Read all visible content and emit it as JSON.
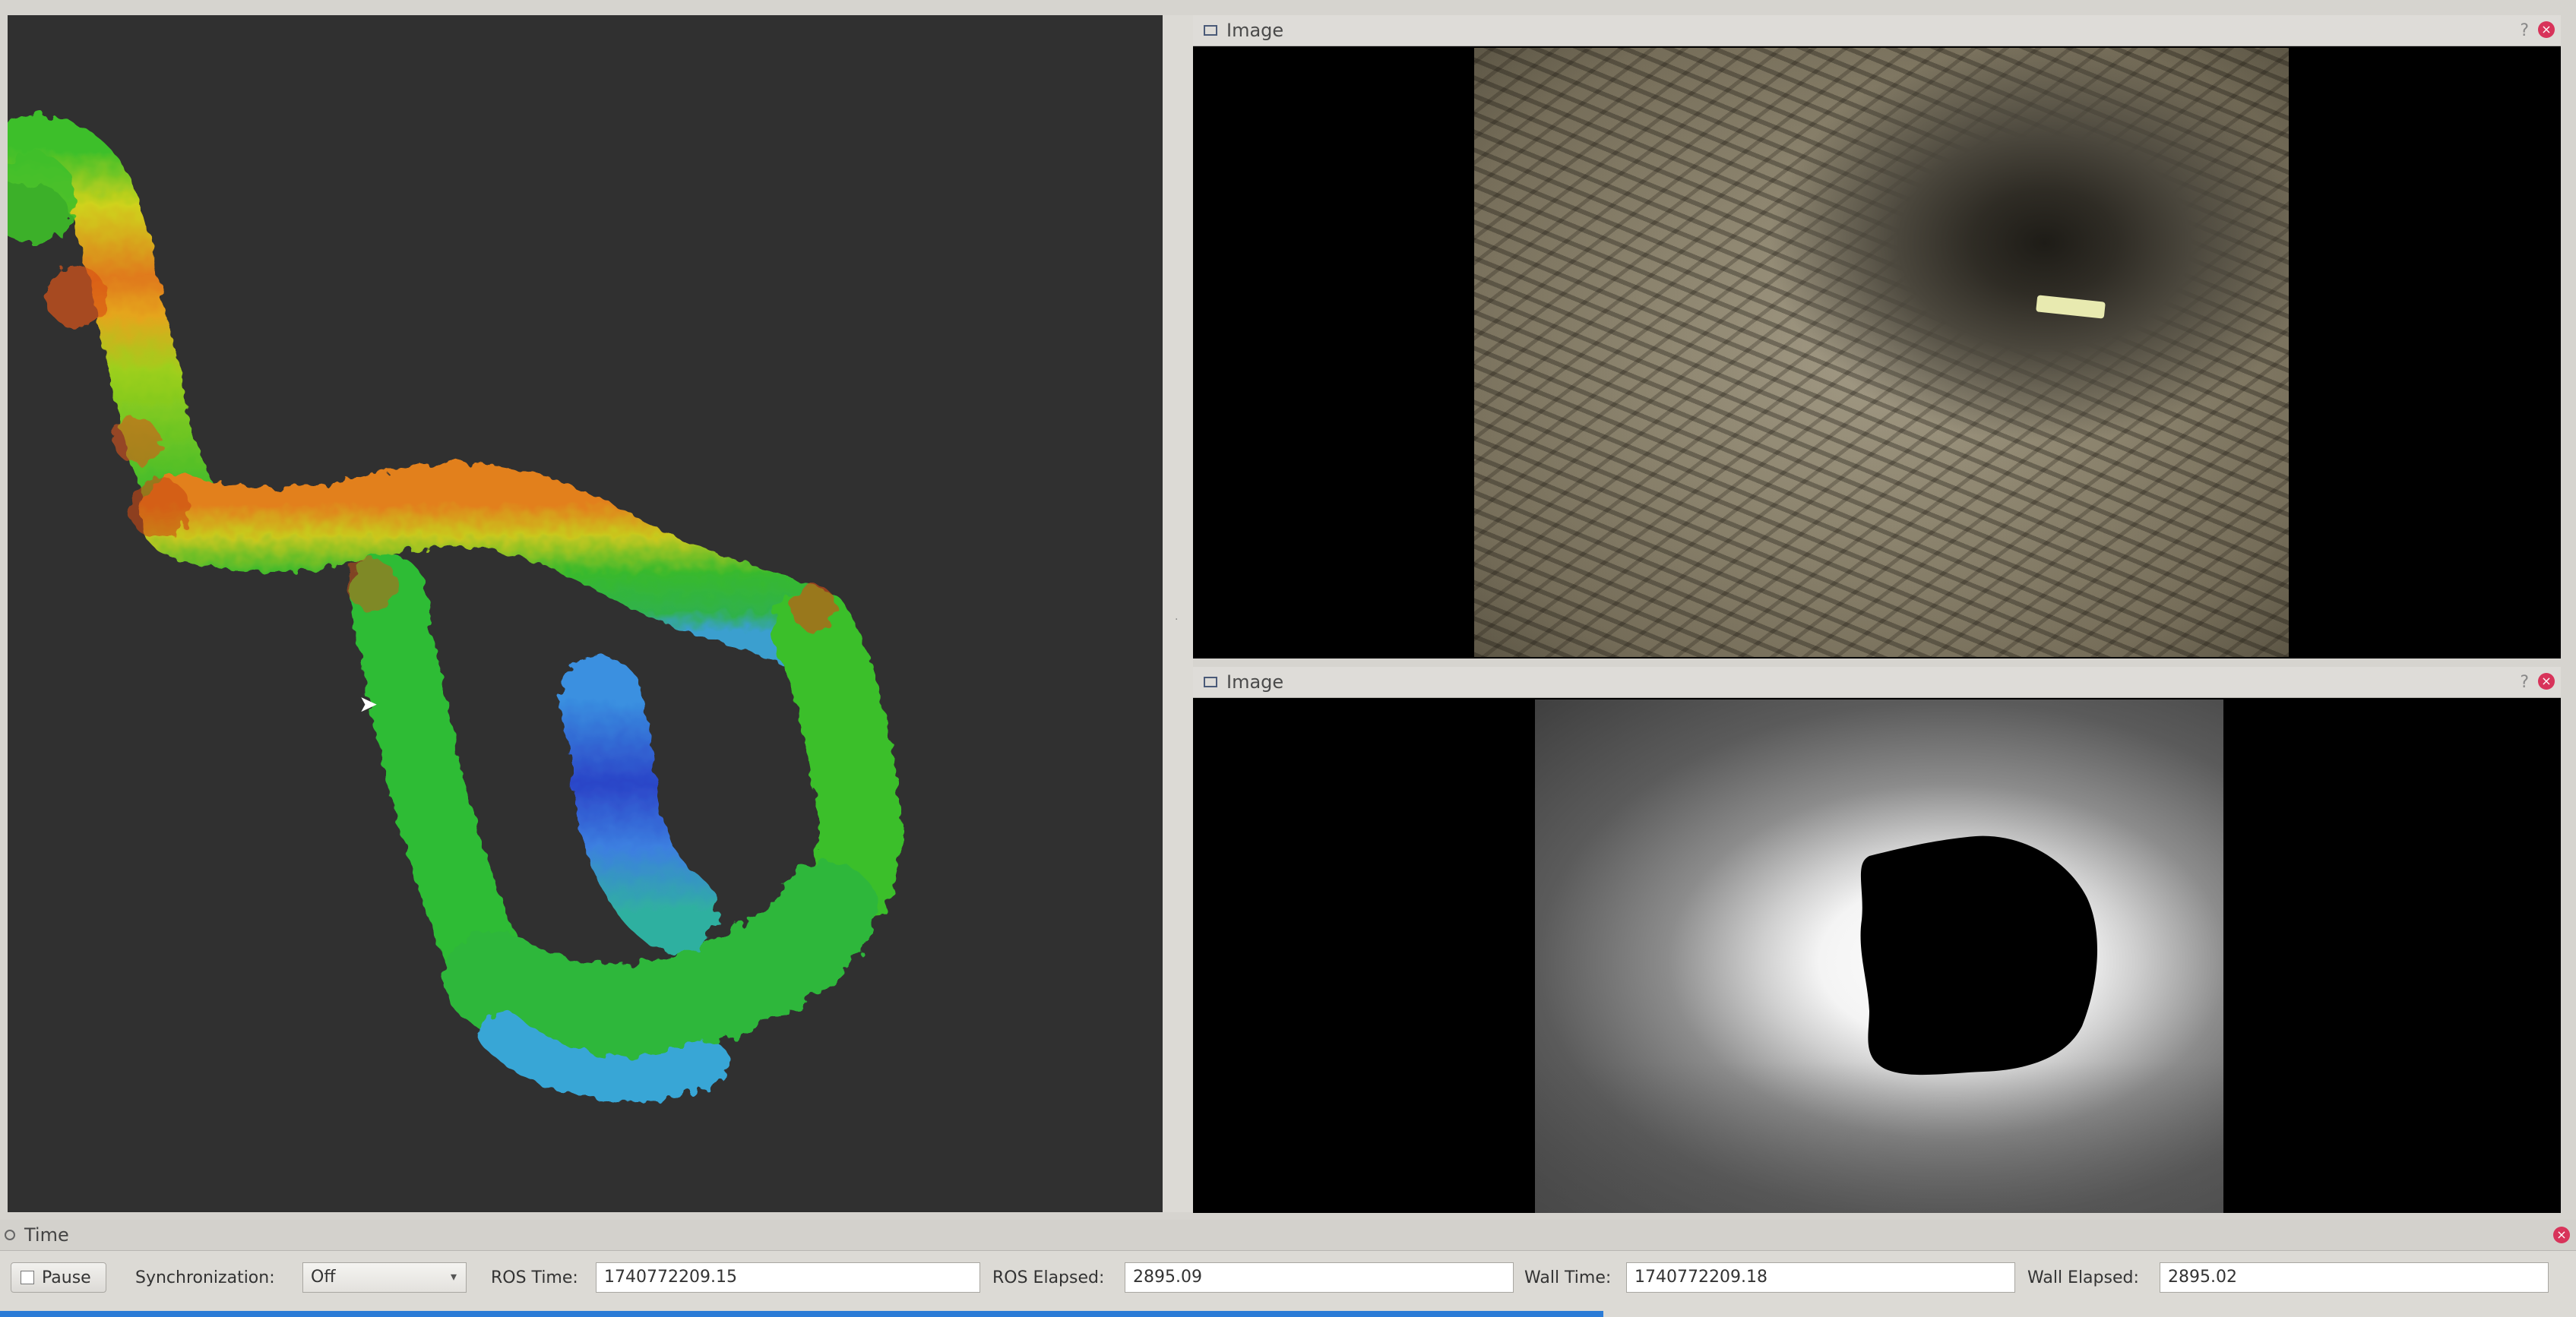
{
  "view3d": {
    "name": "3D point cloud view"
  },
  "image_panels": [
    {
      "title": "Image",
      "help": "?",
      "close": "×"
    },
    {
      "title": "Image",
      "help": "?",
      "close": "×"
    }
  ],
  "time_panel": {
    "title": "Time",
    "close": "×",
    "pause_label": "Pause",
    "sync_label": "Synchronization:",
    "sync_value": "Off",
    "ros_time_label": "ROS Time:",
    "ros_time_value": "1740772209.15",
    "ros_elapsed_label": "ROS Elapsed:",
    "ros_elapsed_value": "2895.09",
    "wall_time_label": "Wall Time:",
    "wall_time_value": "1740772209.18",
    "wall_elapsed_label": "Wall Elapsed:",
    "wall_elapsed_value": "2895.02"
  },
  "colors": {
    "viewport_bg": "#303030",
    "panel_bg": "#000000",
    "close_button": "#d8335a",
    "progress": "#2b7bd6"
  },
  "icons": [
    "image-panel-icon",
    "help-icon",
    "close-icon",
    "time-icon",
    "dropdown-arrow-icon",
    "mouse-cursor-icon"
  ]
}
